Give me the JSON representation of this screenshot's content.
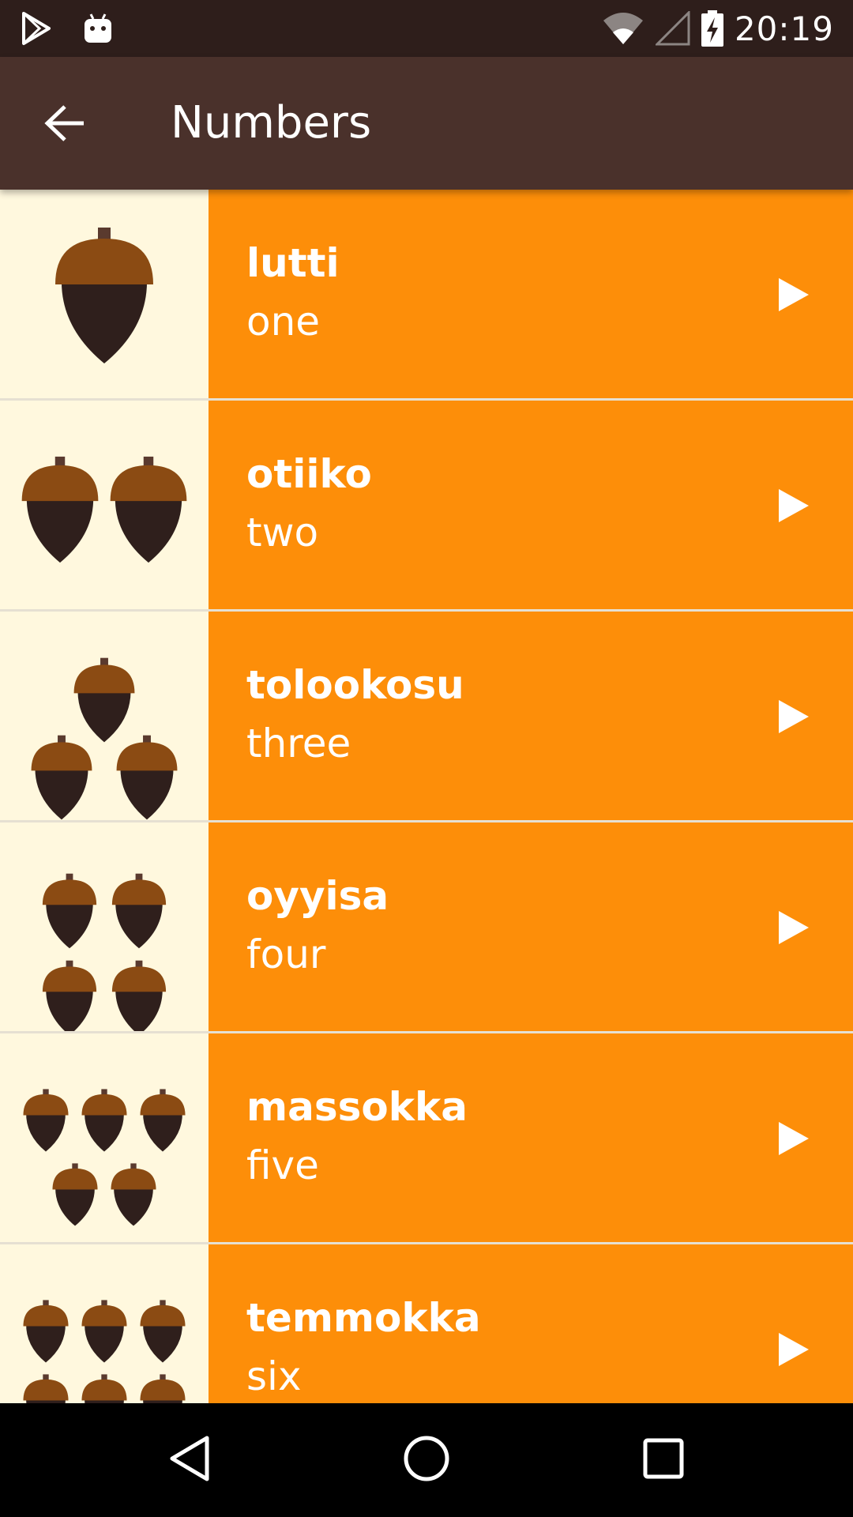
{
  "status_bar": {
    "time": "20:19",
    "icons": [
      "play-store-icon",
      "android-debug-icon",
      "wifi-icon",
      "signal-icon",
      "battery-charging-icon"
    ]
  },
  "app_bar": {
    "title": "Numbers",
    "back_icon": "arrow-back-icon"
  },
  "colors": {
    "status_bar": "#2E1E1B",
    "app_bar": "#4A312B",
    "item_background": "#FD8E09",
    "image_background": "#FFF8DE",
    "acorn_cap": "#8B4B13",
    "acorn_body": "#2F1F1C"
  },
  "words": [
    {
      "miwok": "lutti",
      "english": "one",
      "acorns": 1
    },
    {
      "miwok": "otiiko",
      "english": "two",
      "acorns": 2
    },
    {
      "miwok": "tolookosu",
      "english": "three",
      "acorns": 3
    },
    {
      "miwok": "oyyisa",
      "english": "four",
      "acorns": 4
    },
    {
      "miwok": "massokka",
      "english": "five",
      "acorns": 5
    },
    {
      "miwok": "temmokka",
      "english": "six",
      "acorns": 6
    }
  ],
  "nav_bar": {
    "icons": [
      "nav-back-icon",
      "nav-home-icon",
      "nav-recents-icon"
    ]
  }
}
